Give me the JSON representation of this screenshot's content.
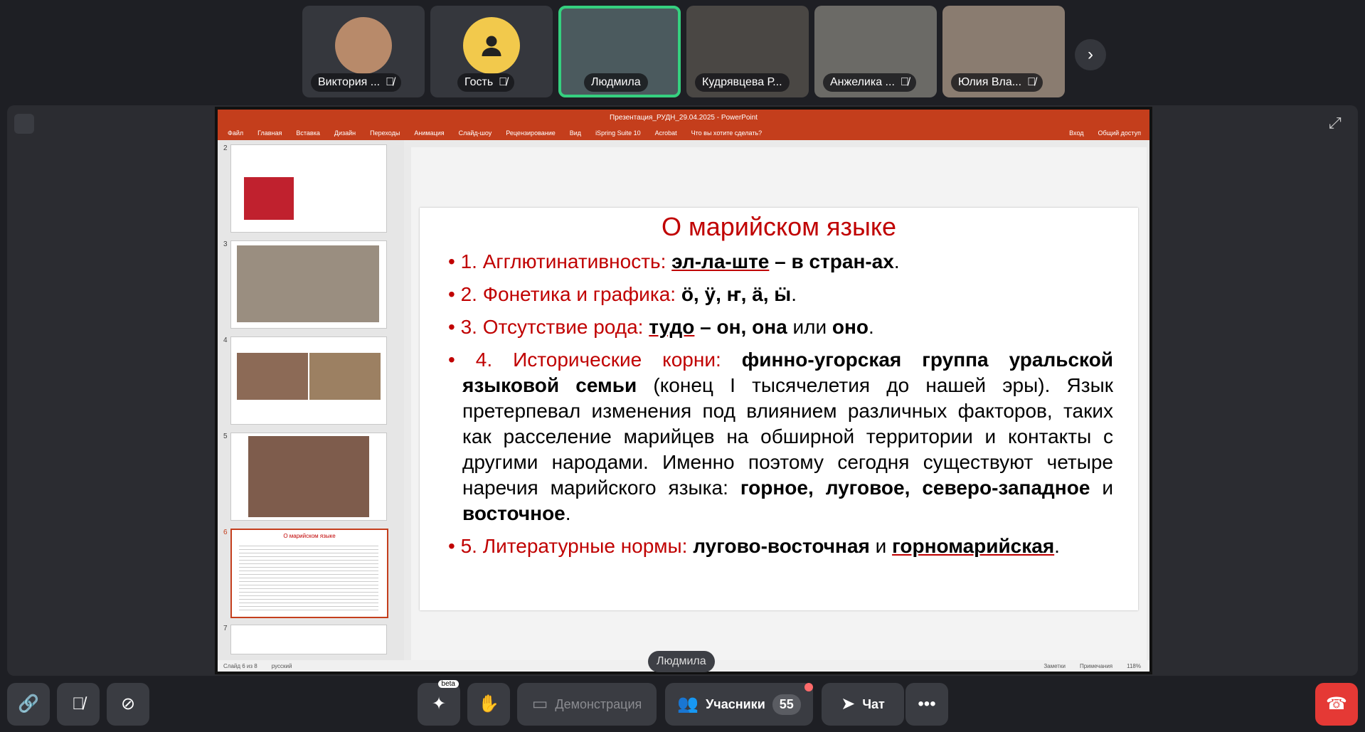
{
  "participants": [
    {
      "name": "Виктория ...",
      "muted": true,
      "avatar": "photo"
    },
    {
      "name": "Гость",
      "muted": true,
      "avatar": "person-icon"
    },
    {
      "name": "Людмила",
      "muted": false,
      "avatar": "video",
      "active": true
    },
    {
      "name": "Кудрявцева Р...",
      "muted": false,
      "avatar": "video"
    },
    {
      "name": "Анжелика ...",
      "muted": true,
      "avatar": "video"
    },
    {
      "name": "Юлия Вла...",
      "muted": true,
      "avatar": "video"
    }
  ],
  "speaker_label": "Людмила",
  "ppt": {
    "window_title": "Презентация_РУДН_29.04.2025 - PowerPoint",
    "menu": [
      "Файл",
      "Главная",
      "Вставка",
      "Дизайн",
      "Переходы",
      "Анимация",
      "Слайд-шоу",
      "Рецензирование",
      "Вид",
      "iSpring Suite 10",
      "Acrobat",
      "Что вы хотите сделать?"
    ],
    "signin": "Вход",
    "share": "Общий доступ",
    "thumb_numbers": [
      "2",
      "3",
      "4",
      "5",
      "6",
      "7"
    ],
    "status_left": "Слайд 6 из 8",
    "status_lang": "русский",
    "status_notes": "Заметки",
    "status_comments": "Примечания",
    "zoom": "118%"
  },
  "slide": {
    "title": "О марийском языке",
    "b1_label": "1. Агглютинативность:",
    "b1_text": "эл-ла-ште –  в стран-ах",
    "b2_label": "2. Фонетика и графика:",
    "b2_text": "ӧ, ӱ, ҥ, ӓ, ӹ",
    "b3_label": "3. Отсутствие рода:",
    "b3_a": "тудо",
    "b3_b": "– он, она",
    "b3_c": "или",
    "b3_d": "оно",
    "b4_label": "4. Исторические корни:",
    "b4_bold": "финно-угорская группа уральской языковой семьи",
    "b4_text": "(конец I тысячелетия до нашей эры). Язык претерпевал изменения под влиянием различных факторов, таких как расселение марийцев на обширной территории и контакты с другими народами. Именно поэтому сегодня существуют четыре наречия марийского языка:",
    "b4_end_bold1": "горное, луговое, северо-западное",
    "b4_end_and": "и",
    "b4_end_bold2": "восточное",
    "b5_label": "5. Литературные нормы:",
    "b5_a": "лугово-восточная",
    "b5_and": "и",
    "b5_b": "горномарийская"
  },
  "controls": {
    "beta": "beta",
    "screen_share": "Демонстрация",
    "participants_label": "Учасники",
    "participants_count": "55",
    "chat": "Чат"
  },
  "colors": {
    "accent_green": "#35d07f",
    "ppt_red": "#c43e1c",
    "slide_red": "#c00000",
    "hangup": "#e53935"
  }
}
